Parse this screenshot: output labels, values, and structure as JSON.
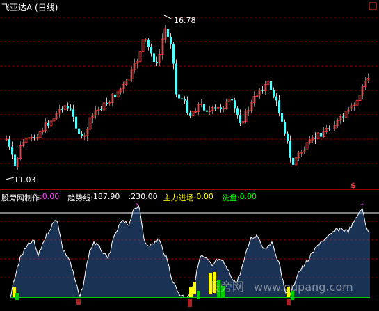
{
  "title": "飞亚达A (日线)",
  "main": {
    "high_label": "16.78",
    "low_label": "11.03",
    "signal_glyph": "$"
  },
  "indicator": {
    "name": "股旁网制作",
    "name_value": ":0.00",
    "trend_label": "趋势线:",
    "trend_value": "187.90",
    "level_value": ":230.00",
    "main_force_label": "主力进场:",
    "main_force_value": "0.00",
    "wash_label": "洗盘:",
    "wash_value": "0.00",
    "reference_level": 230
  },
  "watermark": {
    "cn": "股旁网",
    "url": "www.gupang.com"
  },
  "colors": {
    "up_candle": "#ff3c3c",
    "down_candle": "#54ffff",
    "grid": "#8a0000",
    "trend_line": "#ffffff",
    "histogram": "#3366aa",
    "yellow_bar": "#ffff00",
    "green_bar": "#00cc00",
    "label_magenta": "#ff40ff"
  },
  "chart_data": {
    "type": "candlestick",
    "price_min": 11.03,
    "price_max": 16.78
  }
}
